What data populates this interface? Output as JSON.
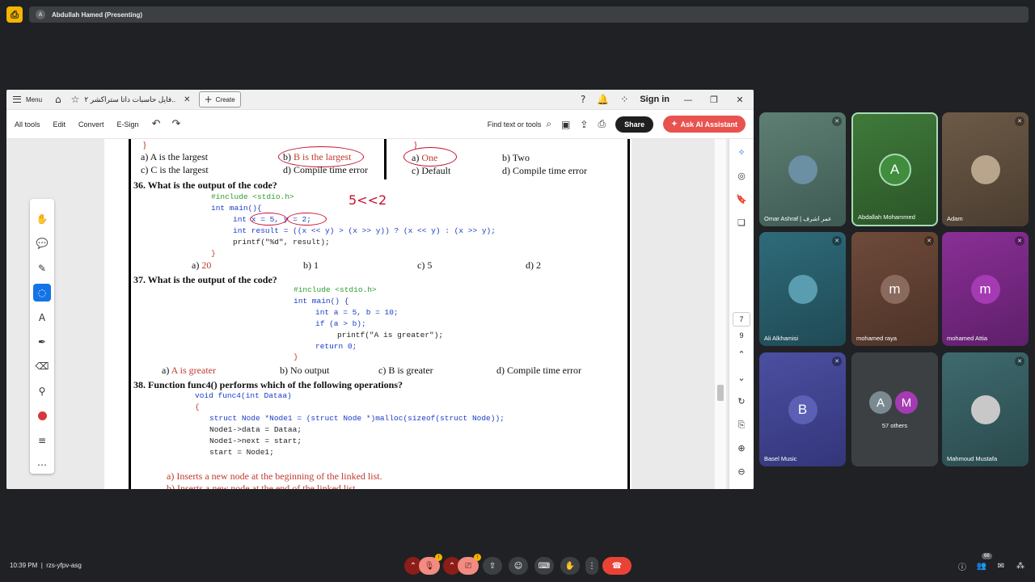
{
  "meet": {
    "presenter_initial": "A",
    "presenting_label": "Abdullah Hamed (Presenting)",
    "time": "10:39 PM",
    "meeting_code": "rzs-yfpv-asg",
    "participants_badge": "66"
  },
  "pdf": {
    "menu_label": "Menu",
    "tab_title": "فايل حاسبات داتا ستراكشر ٢..",
    "create_label": "Create",
    "sign_in": "Sign in",
    "tools": [
      "All tools",
      "Edit",
      "Convert",
      "E-Sign"
    ],
    "find_label": "Find text or tools",
    "share_label": "Share",
    "ai_label": "Ask AI Assistant",
    "page_current": "7",
    "page_total": "9"
  },
  "doc": {
    "prev_left": {
      "a": "a) A is the largest",
      "b_prefix": "b) ",
      "b": "B is the largest",
      "c": "c) C is the largest",
      "d": "d) Compile time error"
    },
    "prev_right": {
      "a_prefix": "a) ",
      "a": "One",
      "b": "b) Two",
      "c": "c) Default",
      "d": "d) Compile time error"
    },
    "brace": "}",
    "q36": "36. What is the output of the code?",
    "q36_code": [
      "#include <stdio.h>",
      "int main(){",
      "int x = 5, y = 2;",
      "int result = ((x << y) > (x >> y)) ? (x << y) : (x >> y);",
      "printf(\"%d\", result);",
      "}"
    ],
    "q36_note": "5<<2",
    "q36_opts": {
      "a_prefix": "a) ",
      "a": "20",
      "b": "b) 1",
      "c": "c) 5",
      "d": "d) 2"
    },
    "q37": "37. What is the output of the code?",
    "q37_code": [
      "#include <stdio.h>",
      "int main() {",
      "int a = 5, b = 10;",
      "if (a > b);",
      "printf(\"A is greater\");",
      "return 0;",
      "}"
    ],
    "q37_opts": {
      "a_prefix": "a) ",
      "a": "A is greater",
      "b": "b) No output",
      "c": "c) B is greater",
      "d": "d) Compile time error"
    },
    "q38": "38. Function func4() performs which of the following operations?",
    "q38_code": [
      "void func4(int Dataa)",
      "{",
      "struct Node *Node1 = (struct Node *)malloc(sizeof(struct Node));",
      "Node1->data = Dataa;",
      "Node1->next = start;",
      "start = Node1;"
    ],
    "q38_opts": {
      "a": "a) Inserts a new node at the beginning of the linked list.",
      "b": "b) Inserts a new node at the end of the linked list."
    }
  },
  "participants": [
    {
      "name": "Omar Ashraf | عمر اشرف",
      "initial": ""
    },
    {
      "name": "Abdallah Mohammed",
      "initial": "A"
    },
    {
      "name": "Adam",
      "initial": ""
    },
    {
      "name": "Ali Alkhamisi",
      "initial": ""
    },
    {
      "name": "mohamed raya",
      "initial": "m"
    },
    {
      "name": "mohamed Attia",
      "initial": "m"
    },
    {
      "name": "Basel Music",
      "initial": "B"
    },
    {
      "name": "57 others",
      "initial": "A",
      "initial2": "M"
    },
    {
      "name": "Mahmoud Mustafa",
      "initial": ""
    }
  ],
  "colors": {
    "accent_red": "#c8102e",
    "meet_bg": "#202124",
    "leave_red": "#ea4335",
    "muted_red": "#8c1d18"
  }
}
